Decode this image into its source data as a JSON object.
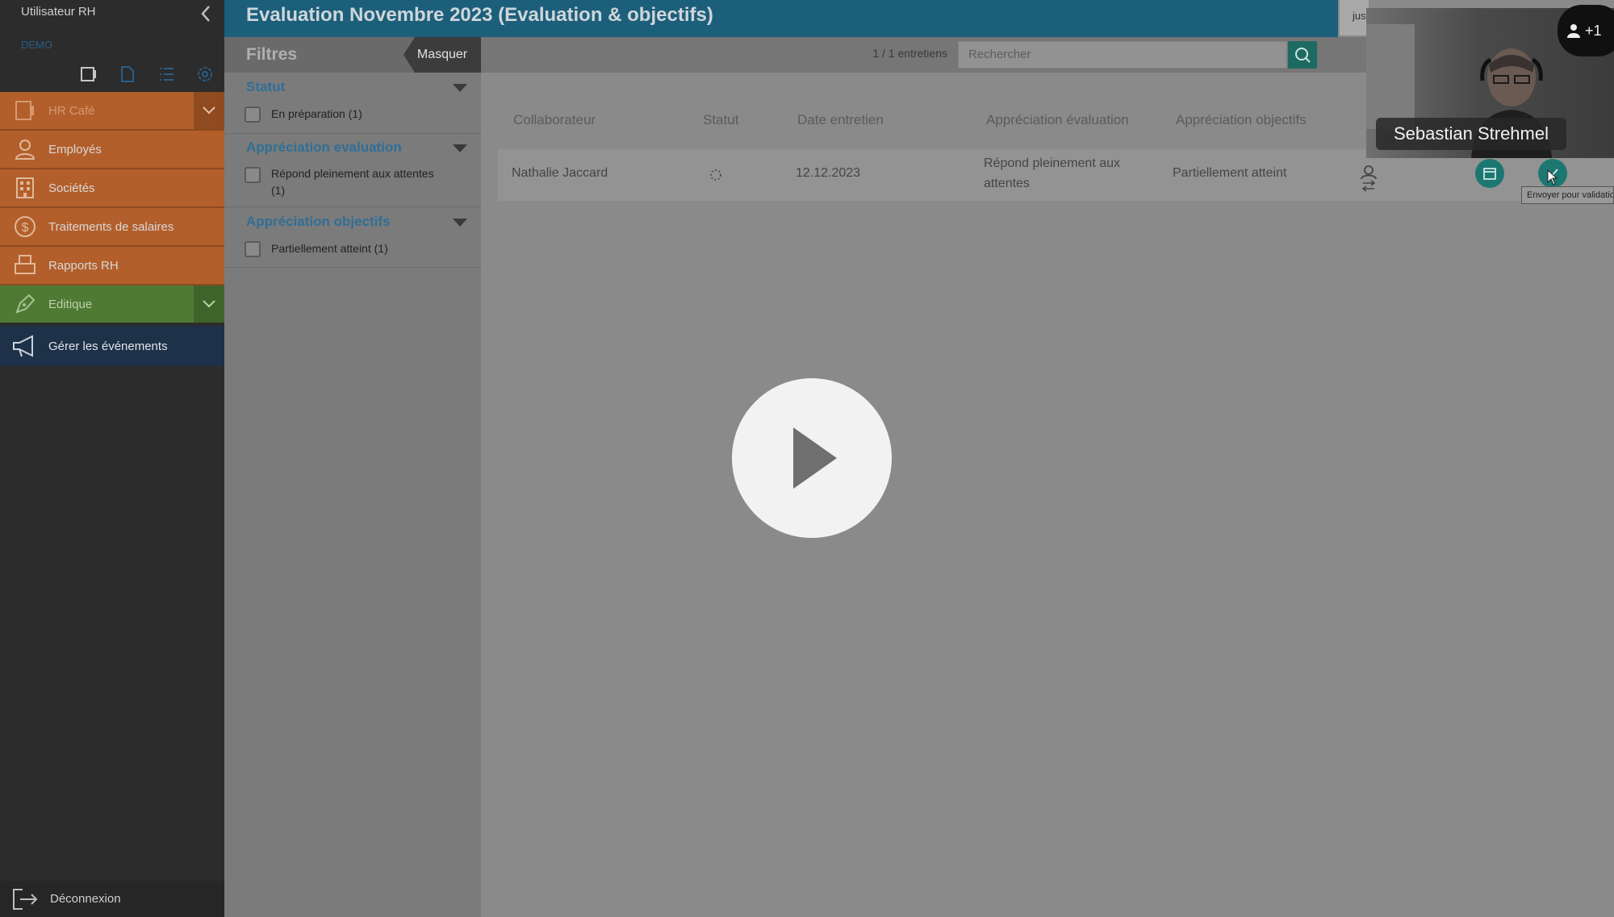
{
  "sidebar": {
    "user_label": "Utilisateur RH",
    "demo_label": "DEMO",
    "items": [
      {
        "label": "HR Café",
        "icon": "tablet-icon"
      },
      {
        "label": "Employés",
        "icon": "person-icon"
      },
      {
        "label": "Sociétés",
        "icon": "building-icon"
      },
      {
        "label": "Traitements de salaires",
        "icon": "dollar-icon"
      },
      {
        "label": "Rapports RH",
        "icon": "printer-icon"
      },
      {
        "label": "Editique",
        "icon": "pen-icon"
      },
      {
        "label": "Gérer les événements",
        "icon": "megaphone-icon"
      }
    ],
    "logout_label": "Déconnexion"
  },
  "header": {
    "title": "Evaluation Novembre 2023 (Evaluation & objectifs)",
    "just_tab": "just"
  },
  "toolbar": {
    "filters_title": "Filtres",
    "hide_label": "Masquer",
    "count": "1 / 1 entretiens",
    "search_placeholder": "Rechercher"
  },
  "filters": [
    {
      "title": "Statut",
      "option": "En préparation (1)"
    },
    {
      "title": "Appréciation evaluation",
      "option": "Répond pleinement aux attentes",
      "option_line2": "(1)"
    },
    {
      "title": "Appréciation objectifs",
      "option": "Partiellement atteint (1)"
    }
  ],
  "table": {
    "columns": [
      "Collaborateur",
      "Statut",
      "Date entretien",
      "Appréciation évaluation",
      "Appréciation objectifs"
    ],
    "rows": [
      {
        "collaborateur": "Nathalie Jaccard",
        "date": "12.12.2023",
        "eval_line1": "Répond pleinement aux",
        "eval_line2": "attentes",
        "objectifs": "Partiellement atteint"
      }
    ]
  },
  "tooltip": "Envoyer pour validation",
  "video": {
    "name": "Sebastian Strehmel",
    "participants": "+1"
  },
  "colors": {
    "accent_orange": "#b35f2b",
    "accent_green": "#4f7a34",
    "header_blue": "#1c5f7b",
    "teal": "#1d7771"
  }
}
